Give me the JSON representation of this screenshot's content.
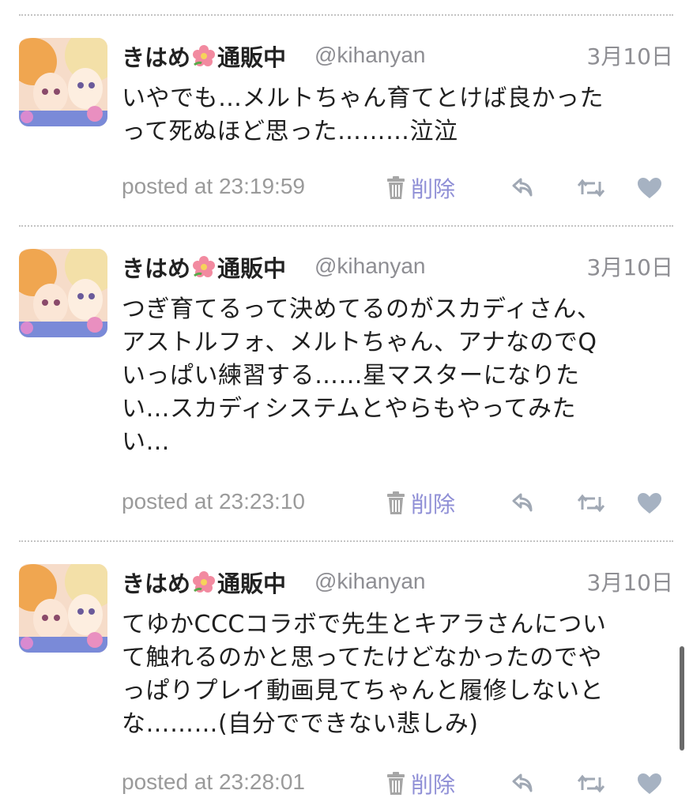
{
  "colors": {
    "name": "#222222",
    "meta_gray": "#8e8e93",
    "delete_purple": "#8f8fd6",
    "icon_gray": "#a0a8b4",
    "divider": "#c4c4c4"
  },
  "tweets": [
    {
      "display_name_before": "きはめ",
      "display_name_after": "通販中",
      "name_emoji": "hibiscus-icon",
      "handle": "@kihanyan",
      "date": "3月10日",
      "text": "いやでも…メルトちゃん育てとけば良かった\nって死ぬほど思った………泣泣",
      "posted": "posted at 23:19:59",
      "delete_label": "削除"
    },
    {
      "display_name_before": "きはめ",
      "display_name_after": "通販中",
      "name_emoji": "hibiscus-icon",
      "handle": "@kihanyan",
      "date": "3月10日",
      "text": "つぎ育てるって決めてるのがスカディさん、\nアストルフォ、メルトちゃん、アナなのでQ\nいっぱい練習する……星マスターになりた\nい…スカディシステムとやらもやってみた\nい…",
      "posted": "posted at 23:23:10",
      "delete_label": "削除"
    },
    {
      "display_name_before": "きはめ",
      "display_name_after": "通販中",
      "name_emoji": "hibiscus-icon",
      "handle": "@kihanyan",
      "date": "3月10日",
      "text": "てゆかCCCコラボで先生とキアラさんについ\nて触れるのかと思ってたけどなかったのでや\nっぱりプレイ動画見てちゃんと履修しないと\nな………(自分でできない悲しみ)",
      "posted": "posted at 23:28:01",
      "delete_label": "削除"
    }
  ]
}
